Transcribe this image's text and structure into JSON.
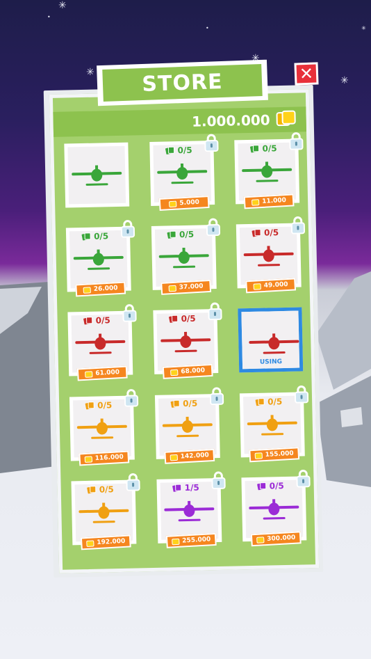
{
  "store": {
    "title": "STORE",
    "close_label": "✕",
    "coins": "1.000.000",
    "items": [
      {
        "cards": "",
        "price": "",
        "color": "#3aa63a",
        "state": "owned"
      },
      {
        "cards": "0/5",
        "price": "5.000",
        "color": "#3aa63a",
        "state": "locked"
      },
      {
        "cards": "0/5",
        "price": "11.000",
        "color": "#3aa63a",
        "state": "locked"
      },
      {
        "cards": "0/5",
        "price": "26.000",
        "color": "#3aa63a",
        "state": "locked"
      },
      {
        "cards": "0/5",
        "price": "37.000",
        "color": "#3aa63a",
        "state": "locked"
      },
      {
        "cards": "0/5",
        "price": "49.000",
        "color": "#c82a2a",
        "state": "locked"
      },
      {
        "cards": "0/5",
        "price": "61.000",
        "color": "#c82a2a",
        "state": "locked"
      },
      {
        "cards": "0/5",
        "price": "68.000",
        "color": "#c82a2a",
        "state": "locked"
      },
      {
        "cards": "",
        "price": "",
        "color": "#c82a2a",
        "state": "using",
        "using_label": "USING"
      },
      {
        "cards": "0/5",
        "price": "116.000",
        "color": "#f0a012",
        "state": "locked"
      },
      {
        "cards": "0/5",
        "price": "142.000",
        "color": "#f0a012",
        "state": "locked"
      },
      {
        "cards": "0/5",
        "price": "155.000",
        "color": "#f0a012",
        "state": "locked"
      },
      {
        "cards": "0/5",
        "price": "192.000",
        "color": "#f0a012",
        "state": "locked"
      },
      {
        "cards": "1/5",
        "price": "255.000",
        "color": "#9b2bd6",
        "state": "locked"
      },
      {
        "cards": "0/5",
        "price": "300.000",
        "color": "#9b2bd6",
        "state": "locked"
      }
    ]
  }
}
